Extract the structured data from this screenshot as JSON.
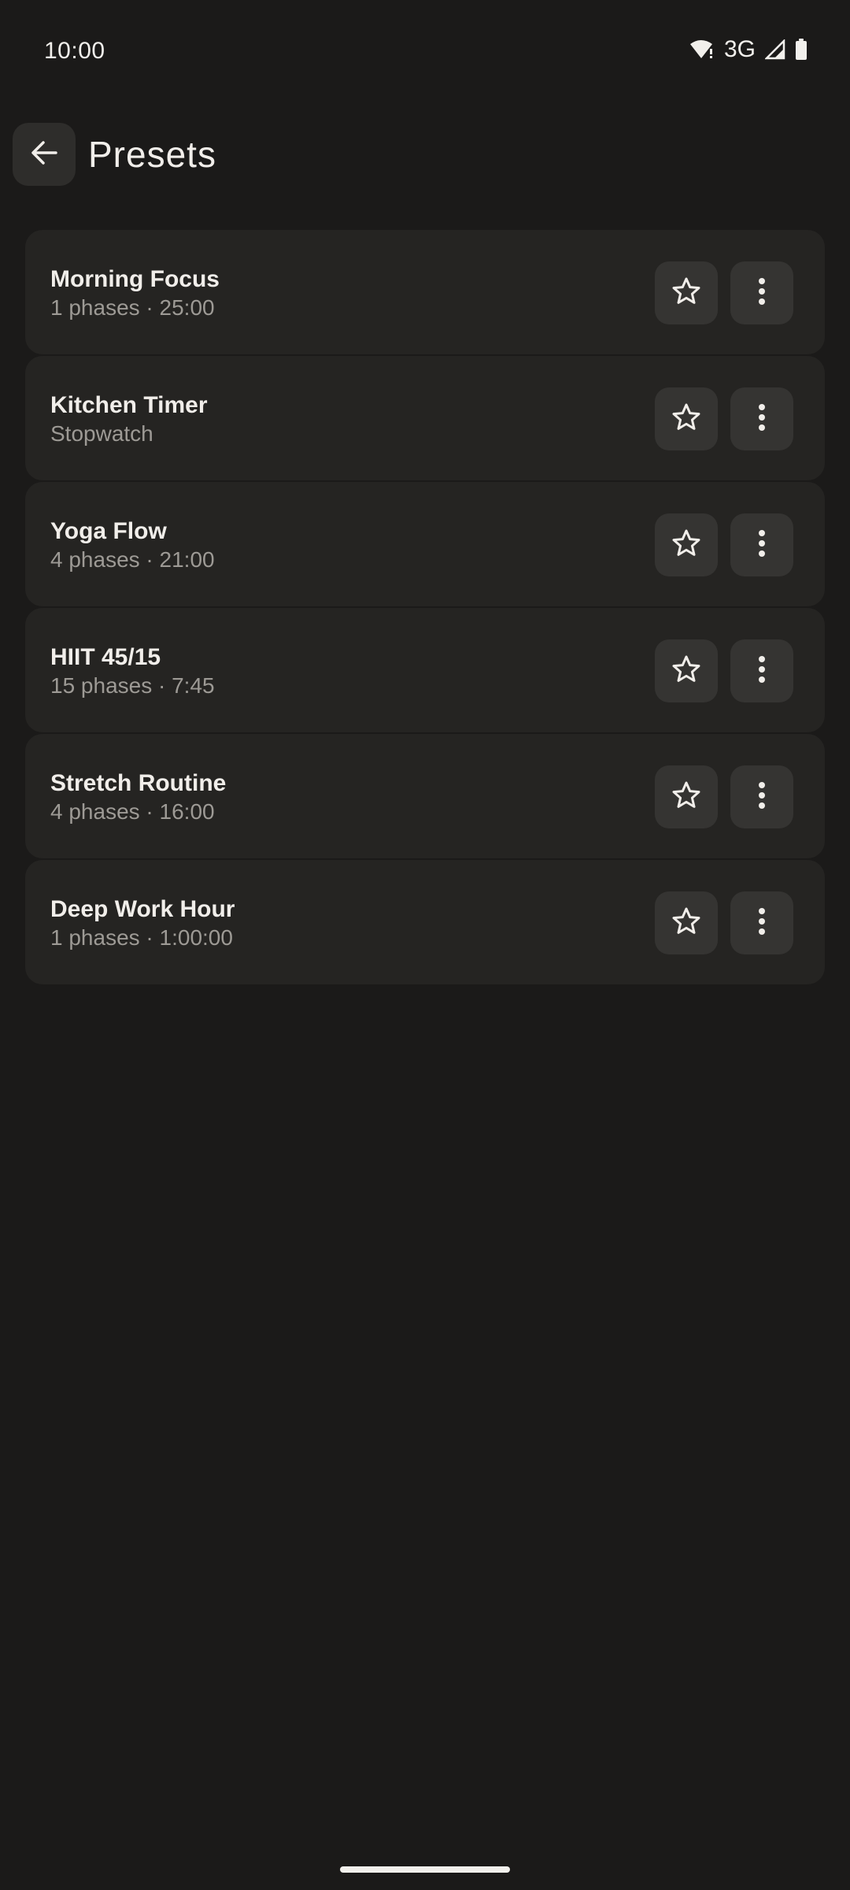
{
  "status_bar": {
    "time": "10:00",
    "network_label": "3G",
    "icons": [
      "wifi-alert-icon",
      "cell-signal-icon",
      "battery-icon"
    ]
  },
  "header": {
    "back_icon": "arrow-left-icon",
    "title": "Presets"
  },
  "presets": [
    {
      "name": "Morning Focus",
      "meta": "1 phases · 25:00"
    },
    {
      "name": "Kitchen Timer",
      "meta": "Stopwatch"
    },
    {
      "name": "Yoga Flow",
      "meta": "4 phases · 21:00"
    },
    {
      "name": "HIIT 45/15",
      "meta": "15 phases · 7:45"
    },
    {
      "name": "Stretch Routine",
      "meta": "4 phases · 16:00"
    },
    {
      "name": "Deep Work Hour",
      "meta": "1 phases · 1:00:00"
    }
  ],
  "colors": {
    "background": "#1b1a19",
    "card": "#252422",
    "button": "#353432",
    "text_primary": "#f1eeea",
    "text_secondary": "#9d9a95"
  }
}
